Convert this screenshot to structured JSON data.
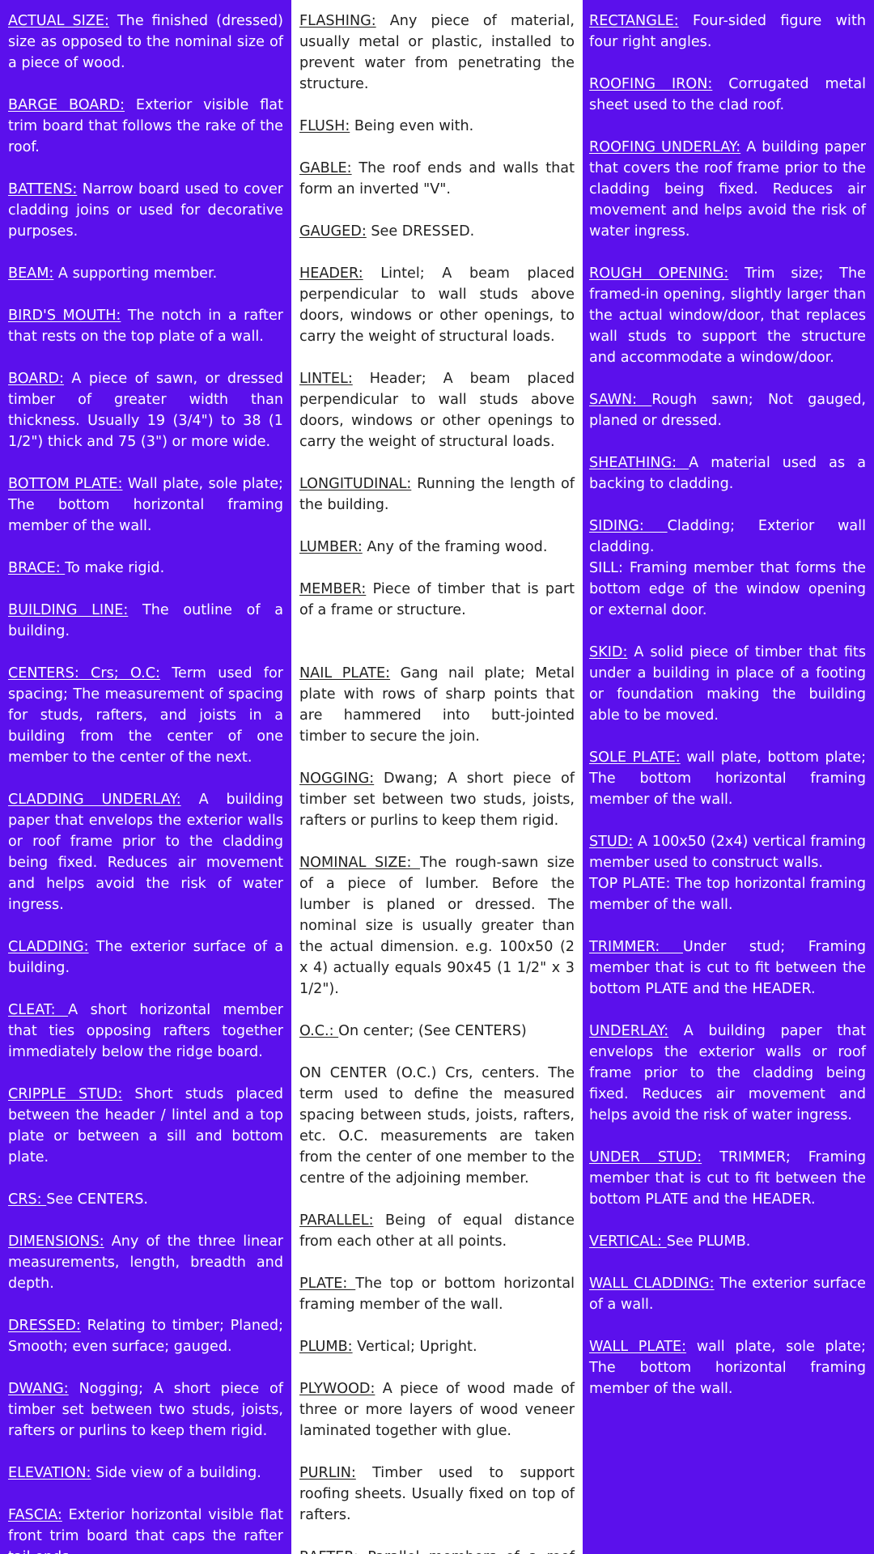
{
  "columns": [
    {
      "entries": [
        {
          "term": "ACTUAL SIZE:",
          "def": " The finished (dressed) size as opposed to the nominal size of a piece of wood."
        },
        {
          "term": "BARGE BOARD:",
          "def": " Exterior visible flat trim board that follows the rake of the roof."
        },
        {
          "term": "BATTENS:",
          "def": " Narrow board used to cover cladding joins or used for decorative purposes."
        },
        {
          "term": "BEAM:",
          "def": " A supporting member."
        },
        {
          "term": "BIRD'S MOUTH:",
          "def": " The notch in a rafter that rests on the top plate of a wall."
        },
        {
          "term": "BOARD:",
          "def": " A piece of sawn, or dressed timber of greater width than thickness. Usually 19 (3/4\") to 38 (1 1/2\") thick and 75 (3\") or more wide."
        },
        {
          "term": "BOTTOM PLATE:",
          "def": " Wall plate, sole plate; The bottom horizontal framing member of the wall."
        },
        {
          "term": "BRACE: ",
          "def": "To make rigid."
        },
        {
          "term": "BUILDING LINE:",
          "def": " The outline of a building."
        },
        {
          "term": "CENTERS: Crs; O.C:",
          "def": " Term used for spacing; The measurement of spacing for studs, rafters, and joists in a building from the center of one member to the center of the next."
        },
        {
          "term": "CLADDING UNDERLAY:",
          "def": " A building paper that envelops the exterior walls or roof frame prior to the cladding being fixed. Reduces air movement and helps avoid the risk of water ingress."
        },
        {
          "term": "CLADDING:",
          "def": " The exterior surface of a building."
        },
        {
          "term": "CLEAT: ",
          "def": "A short horizontal member that ties opposing rafters together immediately below the ridge board."
        },
        {
          "term": "CRIPPLE STUD:",
          "def": " Short studs placed between the header / lintel and a top plate or between a sill and bottom plate."
        },
        {
          "term": "CRS: ",
          "def": "See CENTERS."
        },
        {
          "term": "DIMENSIONS:",
          "def": " Any of the three linear measurements, length, breadth and depth."
        },
        {
          "term": "DRESSED:",
          "def": " Relating to timber; Planed; Smooth; even surface; gauged."
        },
        {
          "term": "DWANG:",
          "def": " Nogging; A short piece of timber set between two studs, joists, rafters or purlins to keep them rigid."
        },
        {
          "term": "ELEVATION:",
          "def": " Side view of a building."
        },
        {
          "term": "FASCIA:",
          "def": " Exterior horizontal visible flat front trim board that caps the rafter tail ends."
        }
      ]
    },
    {
      "entries": [
        {
          "term": "FLASHING:",
          "def": " Any piece of material, usually metal or plastic, installed to prevent water from penetrating the structure."
        },
        {
          "term": "FLUSH:",
          "def": " Being even with."
        },
        {
          "term": "GABLE:",
          "def": " The roof ends and walls that form an inverted \"V\"."
        },
        {
          "term": "GAUGED:",
          "def": " See DRESSED."
        },
        {
          "term": "HEADER:",
          "def": " Lintel; A beam placed perpendicular to wall studs above doors, windows or other openings, to carry the weight of structural loads."
        },
        {
          "term": "LINTEL:",
          "def": " Header; A beam placed perpendicular to wall studs above doors, windows or other openings to carry the weight of structural loads."
        },
        {
          "term": "LONGITUDINAL:",
          "def": " Running the length of the building."
        },
        {
          "term": "LUMBER:",
          "def": " Any of the framing wood."
        },
        {
          "term": "MEMBER:",
          "def": " Piece of timber that is part of a frame or structure.",
          "gap": true
        },
        {
          "term": "NAIL PLATE:",
          "def": " Gang nail plate; Metal plate with rows of sharp points that are hammered into butt-jointed timber to secure the join."
        },
        {
          "term": "NOGGING:",
          "def": " Dwang; A short piece of timber set between two studs, joists, rafters or purlins to keep them rigid."
        },
        {
          "term": "NOMINAL SIZE: ",
          "def": "The rough-sawn size of a piece of lumber. Before the lumber is planed or dressed. The nominal size is usually greater than the actual dimension. e.g. 100x50 (2 x 4) actually equals 90x45 (1 1/2\" x 3 1/2\")."
        },
        {
          "term": "O.C.: ",
          "def": "On center; (See CENTERS)"
        },
        {
          "term": "",
          "def": "ON CENTER (O.C.) Crs, centers. The term used to define the measured spacing between studs, joists, rafters, etc. O.C. measurements are taken from the center of one member to the centre of the adjoining member."
        },
        {
          "term": "PARALLEL:",
          "def": " Being of equal distance from each other at all points."
        },
        {
          "term": "PLATE: ",
          "def": "The top or bottom horizontal framing member of the wall."
        },
        {
          "term": "PLUMB:",
          "def": " Vertical; Upright."
        },
        {
          "term": "PLYWOOD:",
          "def": " A piece of wood made of three or more layers of wood veneer laminated together with glue."
        },
        {
          "term": "PURLIN:",
          "def": " Timber used to support roofing sheets. Usually fixed on top of rafters."
        },
        {
          "term": "RAFTER:",
          "def": " Parallel members of a roof that support battens/purlins and roofing materials."
        }
      ]
    },
    {
      "entries": [
        {
          "term": "RECTANGLE:",
          "def": " Four-sided figure with four right angles."
        },
        {
          "term": "ROOFING IRON:",
          "def": " Corrugated metal sheet used to the clad roof."
        },
        {
          "term": "ROOFING UNDERLAY:",
          "def": " A building paper that covers the roof frame prior to the cladding being fixed. Reduces air movement and helps avoid the risk of water ingress."
        },
        {
          "term": "ROUGH OPENING:",
          "def": " Trim size; The framed-in opening, slightly larger than the actual window/door, that replaces wall studs to support the structure and accommodate a window/door."
        },
        {
          "term": "SAWN: ",
          "def": "Rough sawn; Not gauged, planed or dressed."
        },
        {
          "term": "SHEATHING: ",
          "def": "A material used as a backing to cladding."
        },
        {
          "term": "SIDING: ",
          "def": "Cladding; Exterior wall cladding.",
          "tight": true
        },
        {
          "term": "",
          "def": "SILL: Framing member that forms the bottom edge of the window opening or external door."
        },
        {
          "term": "SKID:",
          "def": " A solid piece of timber that fits under a building in place of a footing or foundation making the building able to be moved."
        },
        {
          "term": "SOLE PLATE:",
          "def": " wall plate, bottom plate; The bottom horizontal framing member of the wall."
        },
        {
          "term": "STUD:",
          "def": " A 100x50 (2x4) vertical framing member used to construct walls.",
          "tight": true
        },
        {
          "term": "",
          "def": "TOP PLATE: The top horizontal framing member of the wall."
        },
        {
          "term": "TRIMMER: ",
          "def": "Under stud; Framing member that is cut to fit between the bottom PLATE and the HEADER."
        },
        {
          "term": "UNDERLAY:",
          "def": " A building paper that envelops the exterior walls or roof frame prior to the cladding being fixed. Reduces air movement and helps avoid the risk of water ingress."
        },
        {
          "term": "UNDER STUD:",
          "def": " TRIMMER; Framing member that is cut to fit between the bottom PLATE and the HEADER."
        },
        {
          "term": "VERTICAL: ",
          "def": "See PLUMB."
        },
        {
          "term": "WALL CLADDING:",
          "def": " The exterior surface of a wall."
        },
        {
          "term": "WALL PLATE:",
          "def": " wall plate, sole plate; The bottom horizontal framing member of the wall."
        }
      ]
    }
  ]
}
